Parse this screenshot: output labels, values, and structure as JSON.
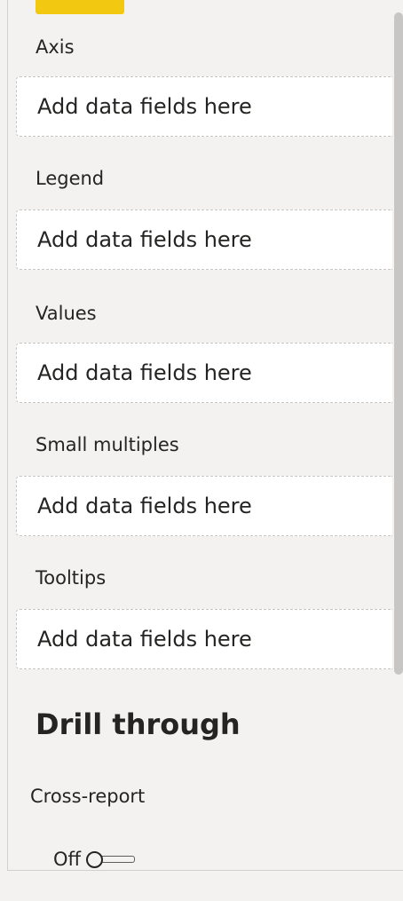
{
  "wells": [
    {
      "label": "Axis",
      "placeholder": "Add data fields here"
    },
    {
      "label": "Legend",
      "placeholder": "Add data fields here"
    },
    {
      "label": "Values",
      "placeholder": "Add data fields here"
    },
    {
      "label": "Small multiples",
      "placeholder": "Add data fields here"
    },
    {
      "label": "Tooltips",
      "placeholder": "Add data fields here"
    }
  ],
  "drill_through": {
    "title": "Drill through",
    "cross_report_label": "Cross-report",
    "toggle_state": "Off"
  },
  "colors": {
    "accent": "#f2c811",
    "panel_bg": "#f3f2f1",
    "well_bg": "#ffffff",
    "dashed_border": "#c8c6c4"
  }
}
